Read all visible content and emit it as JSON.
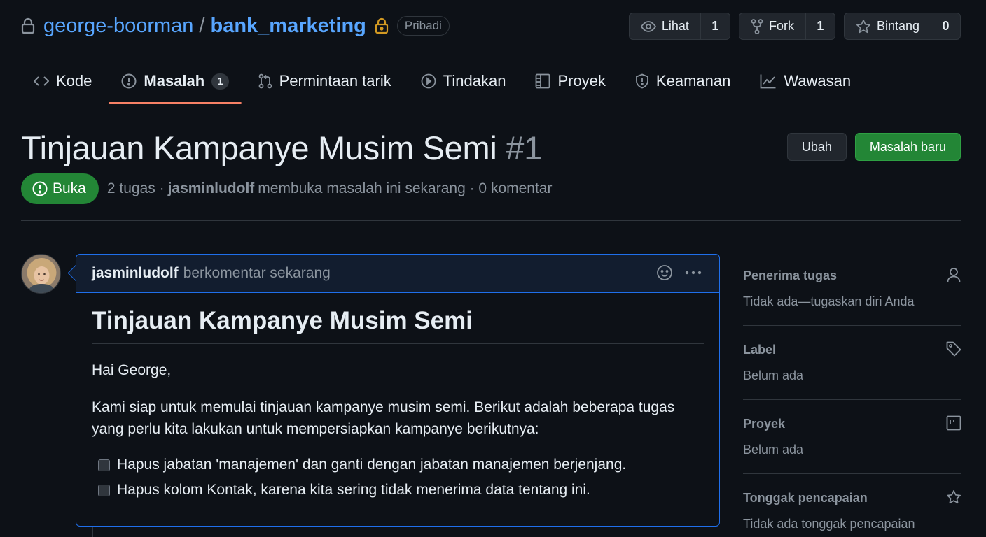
{
  "repo": {
    "owner": "george-boorman",
    "separator": "/",
    "name": "bank_marketing",
    "visibility": "Pribadi"
  },
  "actions": {
    "watch": {
      "label": "Lihat",
      "count": "1"
    },
    "fork": {
      "label": "Fork",
      "count": "1"
    },
    "star": {
      "label": "Bintang",
      "count": "0"
    }
  },
  "nav": {
    "code": "Kode",
    "issues": "Masalah",
    "issues_count": "1",
    "pulls": "Permintaan tarik",
    "actions": "Tindakan",
    "projects": "Proyek",
    "security": "Keamanan",
    "insights": "Wawasan"
  },
  "issue": {
    "title": "Tinjauan Kampanye Musim Semi",
    "number": "#1",
    "edit_label": "Ubah",
    "new_issue_label": "Masalah baru",
    "state": "Buka",
    "tasks": "2 tugas ·",
    "author": "jasminludolf",
    "opened_text": "membuka masalah ini sekarang · 0 komentar"
  },
  "comment": {
    "author": "jasminludolf",
    "time": "berkomentar sekarang",
    "heading": "Tinjauan Kampanye Musim Semi",
    "greeting": "Hai George,",
    "paragraph": "Kami siap untuk memulai tinjauan kampanye musim semi. Berikut adalah beberapa tugas yang perlu kita lakukan untuk mempersiapkan kampanye berikutnya:",
    "tasks": [
      "Hapus jabatan 'manajemen' dan ganti dengan jabatan manajemen berjenjang.",
      "Hapus kolom Kontak, karena kita sering tidak menerima data tentang ini."
    ]
  },
  "sidebar": {
    "assignees": {
      "heading": "Penerima tugas",
      "value": "Tidak ada—tugaskan diri Anda"
    },
    "labels": {
      "heading": "Label",
      "value": "Belum ada"
    },
    "projects": {
      "heading": "Proyek",
      "value": "Belum ada"
    },
    "milestone": {
      "heading": "Tonggak pencapaian",
      "value": "Tidak ada tonggak pencapaian"
    }
  },
  "colors": {
    "background": "#0d1117",
    "link": "#58a6ff",
    "open_state": "#238636",
    "active_tab": "#f78166",
    "comment_border": "#1f6feb"
  }
}
